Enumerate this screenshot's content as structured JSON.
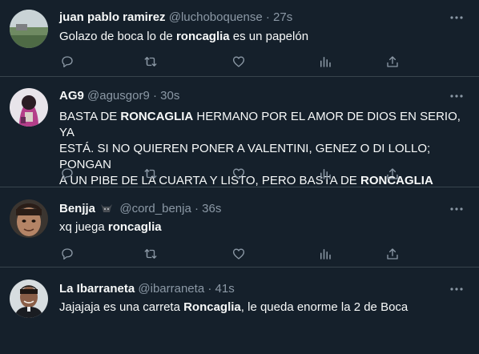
{
  "colors": {
    "background": "#15202b",
    "text": "#f7f9f9",
    "secondary": "#8b98a5",
    "divider": "#38444d"
  },
  "tweets": [
    {
      "name": "juan pablo ramirez",
      "handle": "@luchoboquense",
      "dot": "·",
      "time": "27s",
      "text": [
        "Golazo de boca lo de ",
        "roncaglia",
        " es un papelón"
      ]
    },
    {
      "name": "AG9",
      "handle": "@agusgor9",
      "dot": "·",
      "time": "30s",
      "text": [
        "BASTA DE ",
        "RONCAGLIA",
        " HERMANO POR EL AMOR DE DIOS EN SERIO, YA",
        "ESTÁ. SI NO QUIEREN PONER A VALENTINI, GENEZ O DI LOLLO; PONGAN",
        "A UN PIBE DE LA CUARTA Y LISTO, PERO BASTA DE ",
        "RONCAGLIA"
      ]
    },
    {
      "name": "Benjja",
      "name_emoji": "bull-head-icon",
      "handle": "@cord_benja",
      "dot": "·",
      "time": "36s",
      "text": [
        "xq juega ",
        "roncaglia"
      ]
    },
    {
      "name": "La Ibarraneta",
      "handle": "@ibarraneta",
      "dot": "·",
      "time": "41s",
      "text": [
        "Jajajaja es una carreta ",
        "Roncaglia",
        ", le queda enorme la 2 de Boca"
      ]
    }
  ],
  "action_icons": [
    "reply-icon",
    "retweet-icon",
    "like-icon",
    "views-icon",
    "share-icon"
  ]
}
